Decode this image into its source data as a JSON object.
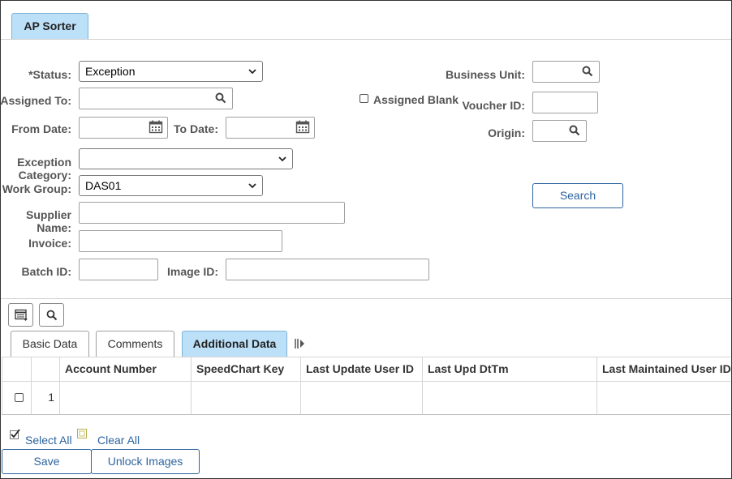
{
  "page_tab": {
    "label": "AP Sorter"
  },
  "form": {
    "status": {
      "label": "*Status:",
      "value": "Exception"
    },
    "assigned_to": {
      "label": "Assigned To:",
      "value": ""
    },
    "assigned_blank": {
      "label": "Assigned Blank",
      "checked": false
    },
    "from_date": {
      "label": "From Date:",
      "value": ""
    },
    "to_date": {
      "label": "To Date:",
      "value": ""
    },
    "exception_category": {
      "label_line1": "Exception",
      "label_line2": "Category:",
      "value": ""
    },
    "work_group": {
      "label": "Work Group:",
      "value": "DAS01"
    },
    "supplier_name": {
      "label_line1": "Supplier",
      "label_line2": "Name:",
      "value": ""
    },
    "invoice": {
      "label": "Invoice:",
      "value": ""
    },
    "batch_id": {
      "label": "Batch ID:",
      "value": ""
    },
    "image_id": {
      "label": "Image ID:",
      "value": ""
    },
    "business_unit": {
      "label": "Business Unit:",
      "value": ""
    },
    "voucher_id": {
      "label": "Voucher ID:",
      "value": ""
    },
    "origin": {
      "label": "Origin:",
      "value": ""
    },
    "search_button": "Search"
  },
  "grid": {
    "tabs": [
      {
        "label": "Basic Data",
        "active": false
      },
      {
        "label": "Comments",
        "active": false
      },
      {
        "label": "Additional Data",
        "active": true
      }
    ],
    "columns": [
      "Account Number",
      "SpeedChart Key",
      "Last Update User ID",
      "Last Upd DtTm",
      "Last Maintained User ID"
    ],
    "rows": [
      {
        "num": "1",
        "cells": [
          "",
          "",
          "",
          "",
          ""
        ]
      }
    ]
  },
  "footer": {
    "select_all": "Select All",
    "clear_all": "Clear All",
    "save": "Save",
    "unlock_images": "Unlock Images"
  },
  "colors": {
    "accent": "#2d64a0",
    "tab_active": "#bde0f9"
  }
}
